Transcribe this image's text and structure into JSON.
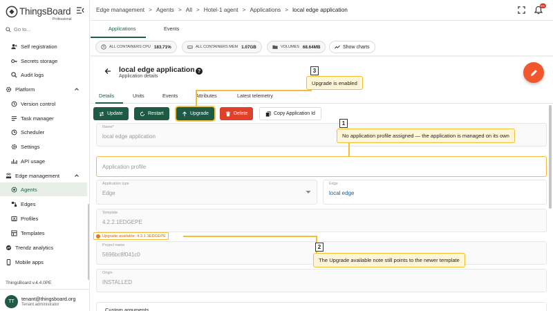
{
  "app": {
    "name": "ThingsBoard",
    "edition": "Professional",
    "version": "ThingsBoard v.4.4.0PE"
  },
  "sidebar": {
    "goto_placeholder": "Go to...",
    "items": [
      {
        "label": "Self registration",
        "icon": "person-add-icon"
      },
      {
        "label": "Secrets storage",
        "icon": "key-icon"
      },
      {
        "label": "Audit logs",
        "icon": "audit-icon"
      },
      {
        "label": "Platform",
        "icon": "gear-icon"
      },
      {
        "label": "Version control",
        "icon": "history-icon"
      },
      {
        "label": "Task manager",
        "icon": "task-icon"
      },
      {
        "label": "Scheduler",
        "icon": "clock-icon"
      },
      {
        "label": "Settings",
        "icon": "gear-icon"
      },
      {
        "label": "API usage",
        "icon": "chart-icon"
      },
      {
        "label": "Edge management",
        "icon": "router-icon"
      },
      {
        "label": "Agents",
        "icon": "target-icon"
      },
      {
        "label": "Edges",
        "icon": "edge-icon"
      },
      {
        "label": "Profiles",
        "icon": "profile-icon"
      },
      {
        "label": "Templates",
        "icon": "template-icon"
      },
      {
        "label": "Trendz analytics",
        "icon": "trendz-icon"
      },
      {
        "label": "Mobile apps",
        "icon": "phone-icon"
      }
    ],
    "user": {
      "initials": "TT",
      "email": "tenant@thingsboard.org",
      "role": "Tenant administrator"
    }
  },
  "topbar": {
    "breadcrumb": [
      "Edge management",
      "Agents",
      "All",
      "Hotel-1 agent",
      "Applications",
      "local edge application"
    ],
    "notification_count": "99+"
  },
  "top_tabs": [
    "Applications",
    "Events"
  ],
  "stats": {
    "cpu_label": "ALL CONTAINERS CPU",
    "cpu_value": "183.71%",
    "mem_label": "ALL CONTAINERS MEM",
    "mem_value": "1.07GB",
    "vol_label": "VOLUMES",
    "vol_value": "68.64MB",
    "charts_btn": "Show charts"
  },
  "detail": {
    "title": "local edge application",
    "subtitle": "Application details",
    "help": "?",
    "tabs": [
      "Details",
      "Units",
      "Events",
      "Attributes",
      "Latest telemetry"
    ],
    "buttons": {
      "update": "Update",
      "restart": "Restart",
      "upgrade": "Upgrade",
      "delete": "Delete",
      "copy_id": "Copy Application Id"
    },
    "fields": {
      "name_label": "Name*",
      "name_value": "local edge application",
      "profile_placeholder": "Application profile",
      "type_label": "Application type",
      "type_value": "Edge",
      "edge_label": "Edge",
      "edge_value": "local edge",
      "template_label": "Template",
      "template_value": "4.2.2.1EDGEPE",
      "upgrade_note": "Upgrade available: 4.3.1.1EDGEPE",
      "project_label": "Project name",
      "project_value": "5696bc8f041c0",
      "origin_label": "Origin",
      "origin_value": "INSTALLED",
      "custom_args": "Custom arguments"
    }
  },
  "callouts": [
    {
      "num": "1",
      "text": "No application profile assigned — the application is managed on its own"
    },
    {
      "num": "2",
      "text": "The Upgrade available note still points to the newer template"
    },
    {
      "num": "3",
      "text": "Upgrade is enabled"
    }
  ],
  "colors": {
    "primary": "#1f5a44",
    "danger": "#e0412b",
    "accent": "#f1572c",
    "highlight": "#f1be35"
  }
}
